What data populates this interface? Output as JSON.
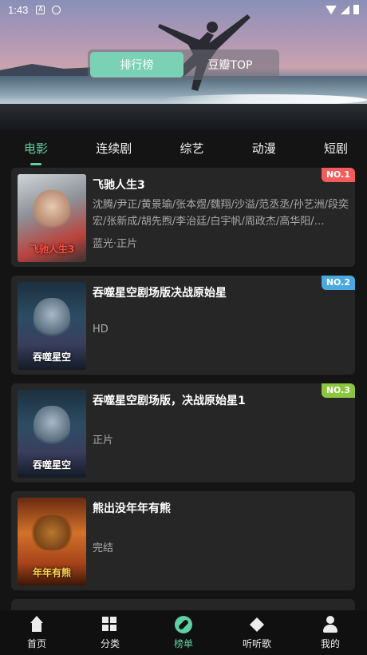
{
  "status_bar": {
    "time": "1:43"
  },
  "toggle": {
    "options": [
      "排行榜",
      "豆瓣TOP"
    ],
    "active": 0
  },
  "tabs": [
    "电影",
    "连续剧",
    "综艺",
    "动漫",
    "短剧"
  ],
  "active_tab": 0,
  "items": [
    {
      "title": "飞驰人生3",
      "cast": "沈腾/尹正/黄景瑜/张本煜/魏翔/沙溢/范丞丞/孙艺洲/段奕宏/张新成/胡先煦/李治廷/白宇帆/周政杰/高华阳/…",
      "status": "蓝光·正片",
      "rank": "NO.1",
      "rank_color": "#f45b5b",
      "poster_text": "飞驰人生3"
    },
    {
      "title": "吞噬星空剧场版决战原始星",
      "cast": "",
      "status": "HD",
      "rank": "NO.2",
      "rank_color": "#4aa9e0",
      "poster_text": "吞噬星空"
    },
    {
      "title": "吞噬星空剧场版，决战原始星1",
      "cast": "",
      "status": "正片",
      "rank": "NO.3",
      "rank_color": "#8cc63f",
      "poster_text": "吞噬星空"
    },
    {
      "title": "熊出没年年有熊",
      "cast": "",
      "status": "完结",
      "rank": "",
      "rank_color": "",
      "poster_text": "年年有熊"
    }
  ],
  "bottom_nav": [
    {
      "label": "首页",
      "icon": "home-icon"
    },
    {
      "label": "分类",
      "icon": "grid-icon"
    },
    {
      "label": "榜单",
      "icon": "compass-icon"
    },
    {
      "label": "听听歌",
      "icon": "cube-icon"
    },
    {
      "label": "我的",
      "icon": "person-icon"
    }
  ],
  "active_nav": 2
}
